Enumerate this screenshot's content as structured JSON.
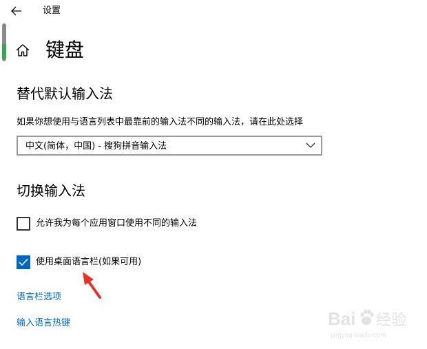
{
  "titlebar": {
    "back_icon": "back-arrow-icon",
    "title": "设置"
  },
  "header": {
    "home_icon": "home-icon",
    "title": "键盘"
  },
  "override_section": {
    "heading": "替代默认输入法",
    "description": "如果你想使用与语言列表中最靠前的输入法不同的输入法，请在此处选择",
    "select": {
      "value": "中文(简体，中国) - 搜狗拼音输入法",
      "chevron_icon": "chevron-down-icon"
    }
  },
  "switch_section": {
    "heading": "切换输入法",
    "options": [
      {
        "label": "允许我为每个应用窗口使用不同的输入法",
        "checked": false
      },
      {
        "label": "使用桌面语言栏(如果可用)",
        "checked": true
      }
    ],
    "links": [
      {
        "label": "语言栏选项"
      },
      {
        "label": "输入语言热键"
      }
    ]
  },
  "annotation": {
    "arrow_color": "#e8302a"
  },
  "watermark": {
    "brand_text": "Baidu 经验",
    "url_text": "jingyan.baidu.com"
  },
  "colors": {
    "accent": "#0067c0",
    "text": "#000000",
    "border": "#999999"
  }
}
